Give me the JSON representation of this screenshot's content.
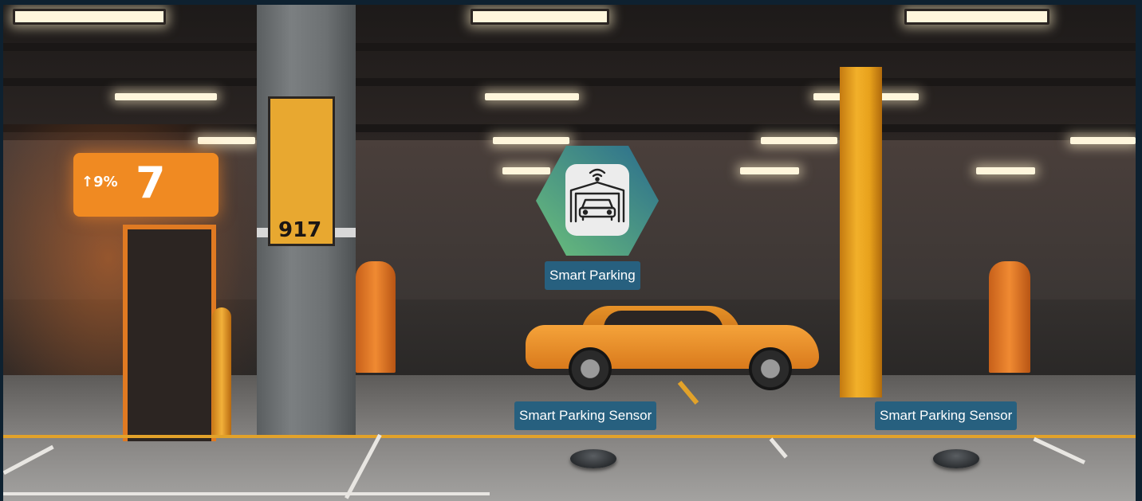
{
  "background_sign": {
    "small_text": "↑9%",
    "big_text": "7"
  },
  "pay_panel": {
    "number": "917"
  },
  "hotspots": {
    "smart_parking": {
      "label": "Smart Parking",
      "icon": "smart-garage-wifi-icon"
    },
    "sensor_1": {
      "label": "Smart Parking Sensor"
    },
    "sensor_2": {
      "label": "Smart Parking Sensor"
    }
  },
  "colors": {
    "label_bg": "#27607f",
    "hex_gradient_start": "#6bbf7a",
    "hex_gradient_end": "#2a6c8e",
    "page_border": "#0e2130"
  }
}
